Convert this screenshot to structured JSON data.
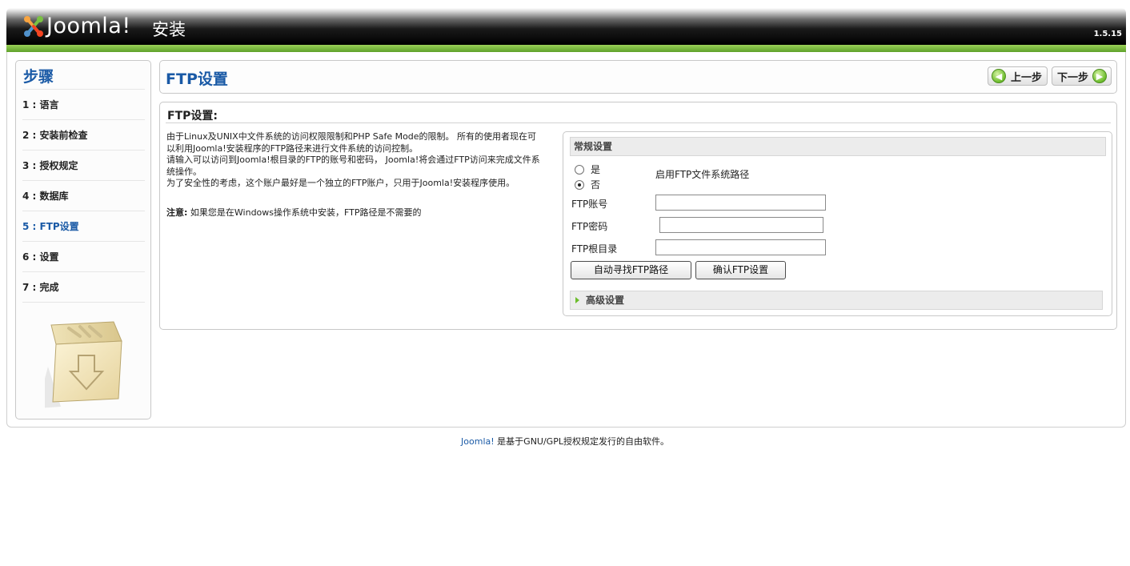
{
  "header": {
    "logo_text": "Joomla!",
    "title": "安装",
    "version": "1.5.15"
  },
  "sidebar": {
    "title": "步骤",
    "steps": [
      {
        "label": "1 : 语言"
      },
      {
        "label": "2 : 安装前检查"
      },
      {
        "label": "3 : 授权规定"
      },
      {
        "label": "4 : 数据库"
      },
      {
        "label": "5 : FTP设置",
        "active": true
      },
      {
        "label": "6 : 设置"
      },
      {
        "label": "7 : 完成"
      }
    ]
  },
  "titlebar": {
    "title": "FTP设置",
    "prev_label": "上一步",
    "next_label": "下一步"
  },
  "main": {
    "section_title": "FTP设置:",
    "description": [
      "由于Linux及UNIX中文件系统的访问权限限制和PHP Safe Mode的限制。 所有的使用者现在可以利用Joomla!安装程序的FTP路径来进行文件系统的访问控制。",
      "请输入可以访问到Joomla!根目录的FTP的账号和密码， Joomla!将会通过FTP访问来完成文件系统操作。",
      "为了安全性的考虑，这个账户最好是一个独立的FTP账户，只用于Joomla!安装程序使用。"
    ],
    "note_label": "注意:",
    "note_text": "如果您是在Windows操作系统中安装，FTP路径是不需要的"
  },
  "settings": {
    "legend": "常规设置",
    "radio_yes": "是",
    "radio_no": "否",
    "selected": "否",
    "enable_label": "启用FTP文件系统路径",
    "ftp_user_label": "FTP账号",
    "ftp_user_value": "",
    "ftp_pass_label": "FTP密码",
    "ftp_pass_value": "",
    "ftp_root_label": "FTP根目录",
    "ftp_root_value": "",
    "autofind_button": "自动寻找FTP路径",
    "verify_button": "确认FTP设置",
    "advanced_label": "高级设置"
  },
  "footer": {
    "link": "Joomla!",
    "text": " 是基于GNU/GPL授权规定发行的自由软件。"
  }
}
